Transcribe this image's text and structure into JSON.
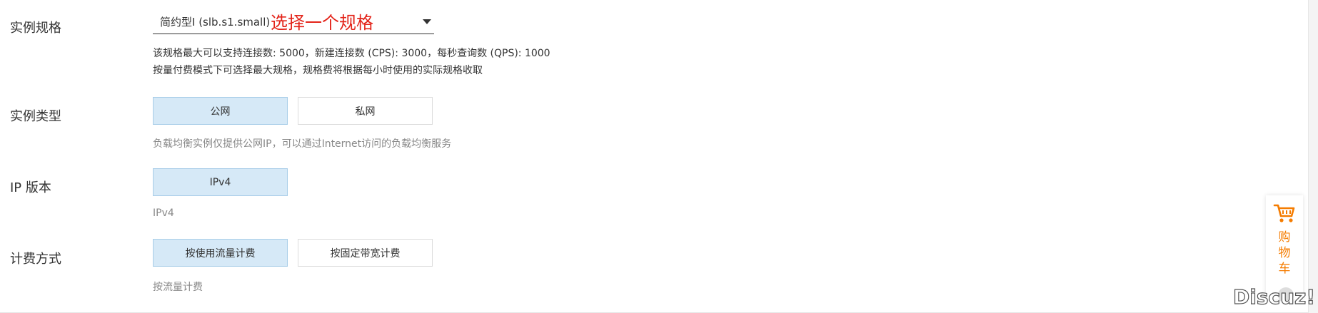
{
  "spec": {
    "label": "实例规格",
    "select_value": "简约型I (slb.s1.small)",
    "hint": "选择一个规格",
    "desc_line1": "该规格最大可以支持连接数: 5000，新建连接数 (CPS): 3000，每秒查询数 (QPS): 1000",
    "desc_line2": "按量付费模式下可选择最大规格，规格费将根据每小时使用的实际规格收取"
  },
  "type": {
    "label": "实例类型",
    "options": [
      "公网",
      "私网"
    ],
    "selected": "公网",
    "desc": "负载均衡实例仅提供公网IP，可以通过Internet访问的负载均衡服务"
  },
  "ip": {
    "label": "IP 版本",
    "options": [
      "IPv4"
    ],
    "selected": "IPv4",
    "desc": "IPv4"
  },
  "billing": {
    "label": "计费方式",
    "options": [
      "按使用流量计费",
      "按固定带宽计费"
    ],
    "selected": "按使用流量计费",
    "desc": "按流量计费"
  },
  "cart": {
    "icon": "cart-icon",
    "text": "购\n物\n车",
    "color": "#f57c00"
  },
  "watermark": "Discuz!",
  "colors": {
    "selected_bg": "#d6e9f7",
    "hint_red": "#e3241a"
  }
}
